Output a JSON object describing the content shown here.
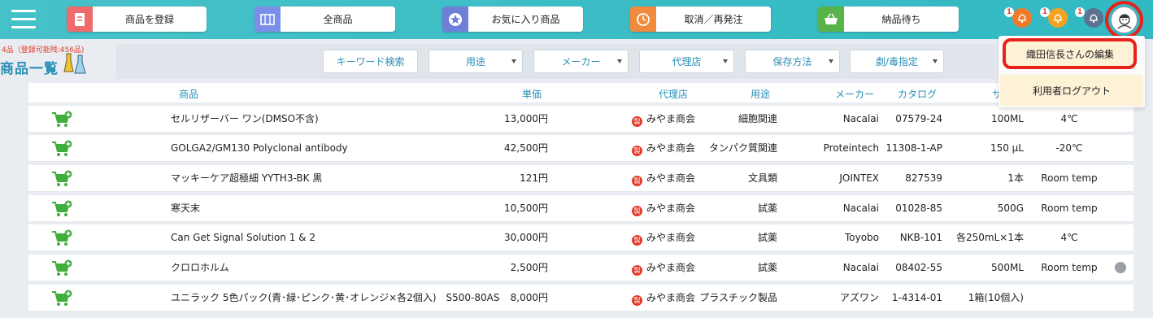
{
  "header": {
    "nav": [
      {
        "label": "商品を登録",
        "icon": "register-product-icon",
        "color": "#ef6b6b"
      },
      {
        "label": "全商品",
        "icon": "all-products-icon",
        "color": "#7b8fe8"
      },
      {
        "label": "お気に入り商品",
        "icon": "favorite-star-icon",
        "color": "#6f7fd8"
      },
      {
        "label": "取消／再発注",
        "icon": "clock-reorder-icon",
        "color": "#f08a3c"
      },
      {
        "label": "納品待ち",
        "icon": "delivery-basket-icon",
        "color": "#58b34a"
      }
    ],
    "notifications": [
      {
        "count": "1",
        "color": "#f07a2a"
      },
      {
        "count": "1",
        "color": "#f3a321"
      },
      {
        "count": "1",
        "color": "#5b7290"
      }
    ]
  },
  "page": {
    "count_note": "4品（登録可能残:456品)",
    "title": "商品一覧"
  },
  "filters": [
    {
      "label": "キーワード検索",
      "dropdown": false
    },
    {
      "label": "用途",
      "dropdown": true
    },
    {
      "label": "メーカー",
      "dropdown": true
    },
    {
      "label": "代理店",
      "dropdown": true
    },
    {
      "label": "保存方法",
      "dropdown": true
    },
    {
      "label": "劇/毒指定",
      "dropdown": true
    }
  ],
  "user_menu": {
    "edit": "織田信長さんの編集",
    "logout": "利用者ログアウト"
  },
  "table": {
    "columns": [
      "商品",
      "単価",
      "代理店",
      "用途",
      "メーカー",
      "カタログ",
      "サ"
    ],
    "seal_char": "製",
    "rows": [
      {
        "name": "セルリザーバー ワン(DMSO不含)",
        "price": "13,000円",
        "agency": "みやま商会",
        "use": "細胞関連",
        "maker": "Nacalai",
        "catalog": "07579-24",
        "size": "100ML",
        "storage": "4℃",
        "hazard": false
      },
      {
        "name": "GOLGA2/GM130 Polyclonal antibody",
        "price": "42,500円",
        "agency": "みやま商会",
        "use": "タンパク質関連",
        "maker": "Proteintech",
        "catalog": "11308-1-AP",
        "size": "150 µL",
        "storage": "-20℃",
        "hazard": false
      },
      {
        "name": "マッキーケア超極細 YYTH3-BK 黒",
        "price": "121円",
        "agency": "みやま商会",
        "use": "文具類",
        "maker": "JOINTEX",
        "catalog": "827539",
        "size": "1本",
        "storage": "Room temp",
        "hazard": false
      },
      {
        "name": "寒天末",
        "price": "10,500円",
        "agency": "みやま商会",
        "use": "試薬",
        "maker": "Nacalai",
        "catalog": "01028-85",
        "size": "500G",
        "storage": "Room temp",
        "hazard": false
      },
      {
        "name": "Can Get Signal Solution 1 & 2",
        "price": "30,000円",
        "agency": "みやま商会",
        "use": "試薬",
        "maker": "Toyobo",
        "catalog": "NKB-101",
        "size": "各250mL×1本",
        "storage": "4℃",
        "hazard": false
      },
      {
        "name": "クロロホルム",
        "price": "2,500円",
        "agency": "みやま商会",
        "use": "試薬",
        "maker": "Nacalai",
        "catalog": "08402-55",
        "size": "500ML",
        "storage": "Room temp",
        "hazard": true
      },
      {
        "name": "ユニラック 5色パック(青･緑･ピンク･黄･オレンジ×各2個入)　S500-80AS",
        "price": "8,000円",
        "agency": "みやま商会",
        "use": "プラスチック製品",
        "maker": "アズワン",
        "catalog": "1-4314-01",
        "size": "1箱(10個入)",
        "storage": "",
        "hazard": false
      }
    ]
  },
  "colors": {
    "header": "#31b9c3",
    "accent_text": "#2a8fb5",
    "highlight_ring": "#e8221b",
    "menu_item_bg": "#fdf1d6"
  }
}
